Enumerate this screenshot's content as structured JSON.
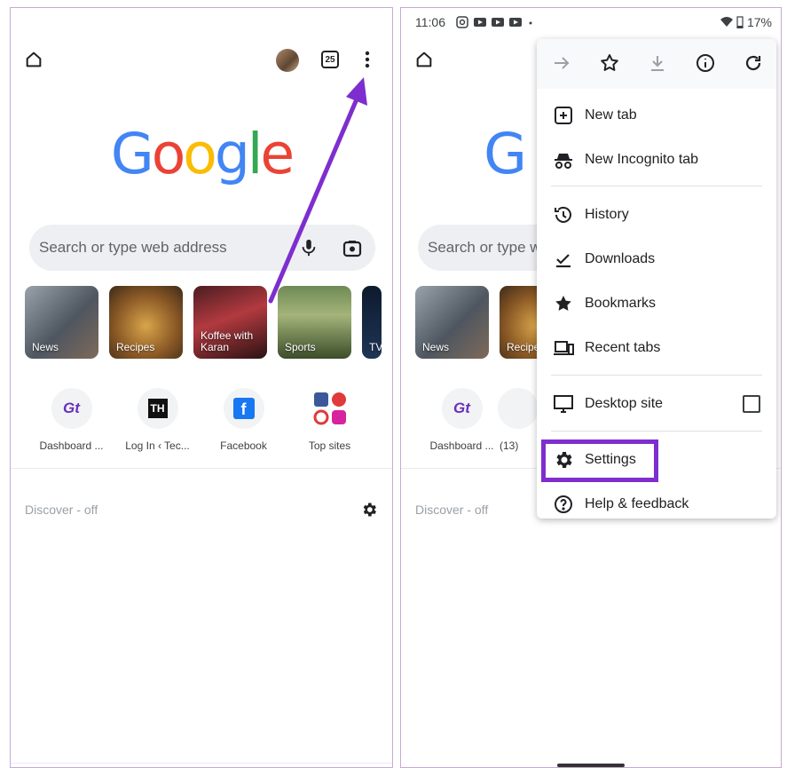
{
  "left": {
    "tab_count": "25",
    "search_placeholder": "Search or type web address",
    "topics": [
      "News",
      "Recipes",
      "Koffee with Karan",
      "Sports",
      "TV"
    ],
    "shortcuts": [
      "Dashboard ...",
      "Log In ‹ Tec...",
      "Facebook",
      "Top sites"
    ],
    "discover_label": "Discover - off"
  },
  "right": {
    "status_time": "11:06",
    "battery": "17%",
    "search_placeholder_partial": "Search or type w",
    "topics": [
      "News",
      "Recipe"
    ],
    "shortcuts": [
      "Dashboard ...",
      "(13)"
    ],
    "discover_label": "Discover - off",
    "menu": {
      "toolbar": [
        "forward-icon",
        "star-icon",
        "download-icon",
        "info-icon",
        "refresh-icon"
      ],
      "items": [
        {
          "label": "New tab",
          "icon": "new-tab-icon"
        },
        {
          "label": "New Incognito tab",
          "icon": "incognito-icon"
        },
        {
          "label": "History",
          "icon": "history-icon"
        },
        {
          "label": "Downloads",
          "icon": "downloads-icon"
        },
        {
          "label": "Bookmarks",
          "icon": "bookmarks-icon"
        },
        {
          "label": "Recent tabs",
          "icon": "recent-tabs-icon"
        },
        {
          "label": "Desktop site",
          "icon": "desktop-icon"
        },
        {
          "label": "Settings",
          "icon": "gear-icon"
        },
        {
          "label": "Help & feedback",
          "icon": "help-icon"
        }
      ],
      "desktop_site_checked": false
    }
  },
  "colors": {
    "accent_annotation": "#7e2ecf",
    "google_blue": "#4285F4",
    "google_red": "#EA4335",
    "google_yellow": "#FBBC05",
    "google_green": "#34A853"
  }
}
